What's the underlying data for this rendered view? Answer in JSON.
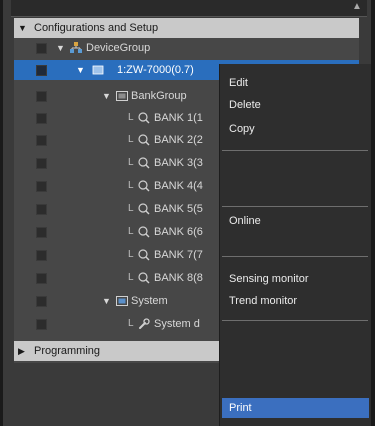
{
  "tree": {
    "configurations": "Configurations and Setup",
    "device_group": "DeviceGroup",
    "device": "1:ZW-7000(0.7)",
    "bank_group": "BankGroup",
    "banks": [
      "BANK 1(1",
      "BANK 2(2",
      "BANK 3(3",
      "BANK 4(4",
      "BANK 5(5",
      "BANK 6(6",
      "BANK 7(7",
      "BANK 8(8"
    ],
    "system": "System",
    "system_child": "System d",
    "programming": "Programming"
  },
  "context_menu": {
    "edit": "Edit",
    "delete": "Delete",
    "copy": "Copy",
    "online": "Online",
    "sensing_monitor": "Sensing monitor",
    "trend_monitor": "Trend monitor",
    "print": "Print"
  },
  "colors": {
    "selected_row": "#2a6ebd",
    "menu_highlight": "#3b6fbf",
    "panel_bg": "#474747"
  }
}
